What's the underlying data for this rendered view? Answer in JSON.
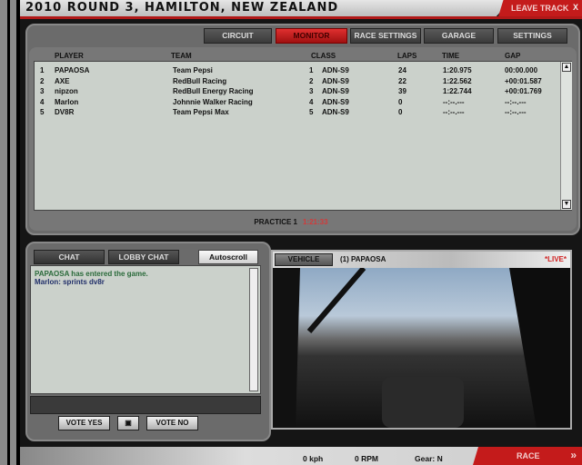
{
  "title": "2010 ROUND 3, HAMILTON, NEW ZEALAND",
  "leave_track": "LEAVE TRACK",
  "close": "X",
  "tabs": [
    "CIRCUIT",
    "MONITOR",
    "RACE SETTINGS",
    "GARAGE",
    "SETTINGS"
  ],
  "active_tab": "MONITOR",
  "columns": [
    "PLAYER",
    "TEAM",
    "CLASS",
    "LAPS",
    "TIME",
    "GAP"
  ],
  "rows": [
    {
      "pos": "1",
      "player": "PAPAOSA",
      "team": "Team Pepsi",
      "cpos": "1",
      "class": "ADN-S9",
      "laps": "24",
      "time": "1:20.975",
      "gap": "00:00.000"
    },
    {
      "pos": "2",
      "player": "AXE",
      "team": "RedBull Racing",
      "cpos": "2",
      "class": "ADN-S9",
      "laps": "22",
      "time": "1:22.562",
      "gap": "+00:01.587"
    },
    {
      "pos": "3",
      "player": "nipzon",
      "team": "RedBull Energy Racing",
      "cpos": "3",
      "class": "ADN-S9",
      "laps": "39",
      "time": "1:22.744",
      "gap": "+00:01.769"
    },
    {
      "pos": "4",
      "player": "Marlon",
      "team": "Johnnie Walker Racing",
      "cpos": "4",
      "class": "ADN-S9",
      "laps": "0",
      "time": "--:--.---",
      "gap": "--:--.---"
    },
    {
      "pos": "5",
      "player": "DV8R",
      "team": "Team Pepsi Max",
      "cpos": "5",
      "class": "ADN-S9",
      "laps": "0",
      "time": "--:--.---",
      "gap": "--:--.---"
    }
  ],
  "session": {
    "label": "PRACTICE 1",
    "timer": "1:21:33"
  },
  "chat": {
    "tab_chat": "CHAT",
    "tab_lobby": "LOBBY CHAT",
    "autoscroll": "Autoscroll",
    "messages": [
      {
        "text": "PAPAOSA has entered the game.",
        "color": "#2a6a3a"
      },
      {
        "text": "Marlon: sprints dv8r",
        "color": "#22306a"
      }
    ]
  },
  "vote": {
    "yes": "VOTE YES",
    "no": "VOTE NO"
  },
  "video": {
    "button": "VEHICLE",
    "driver": "(1) PAPAOSA",
    "live": "*LIVE*"
  },
  "status": {
    "speed": "0 kph",
    "rpm": "0 RPM",
    "gear": "Gear: N"
  },
  "race": "RACE"
}
